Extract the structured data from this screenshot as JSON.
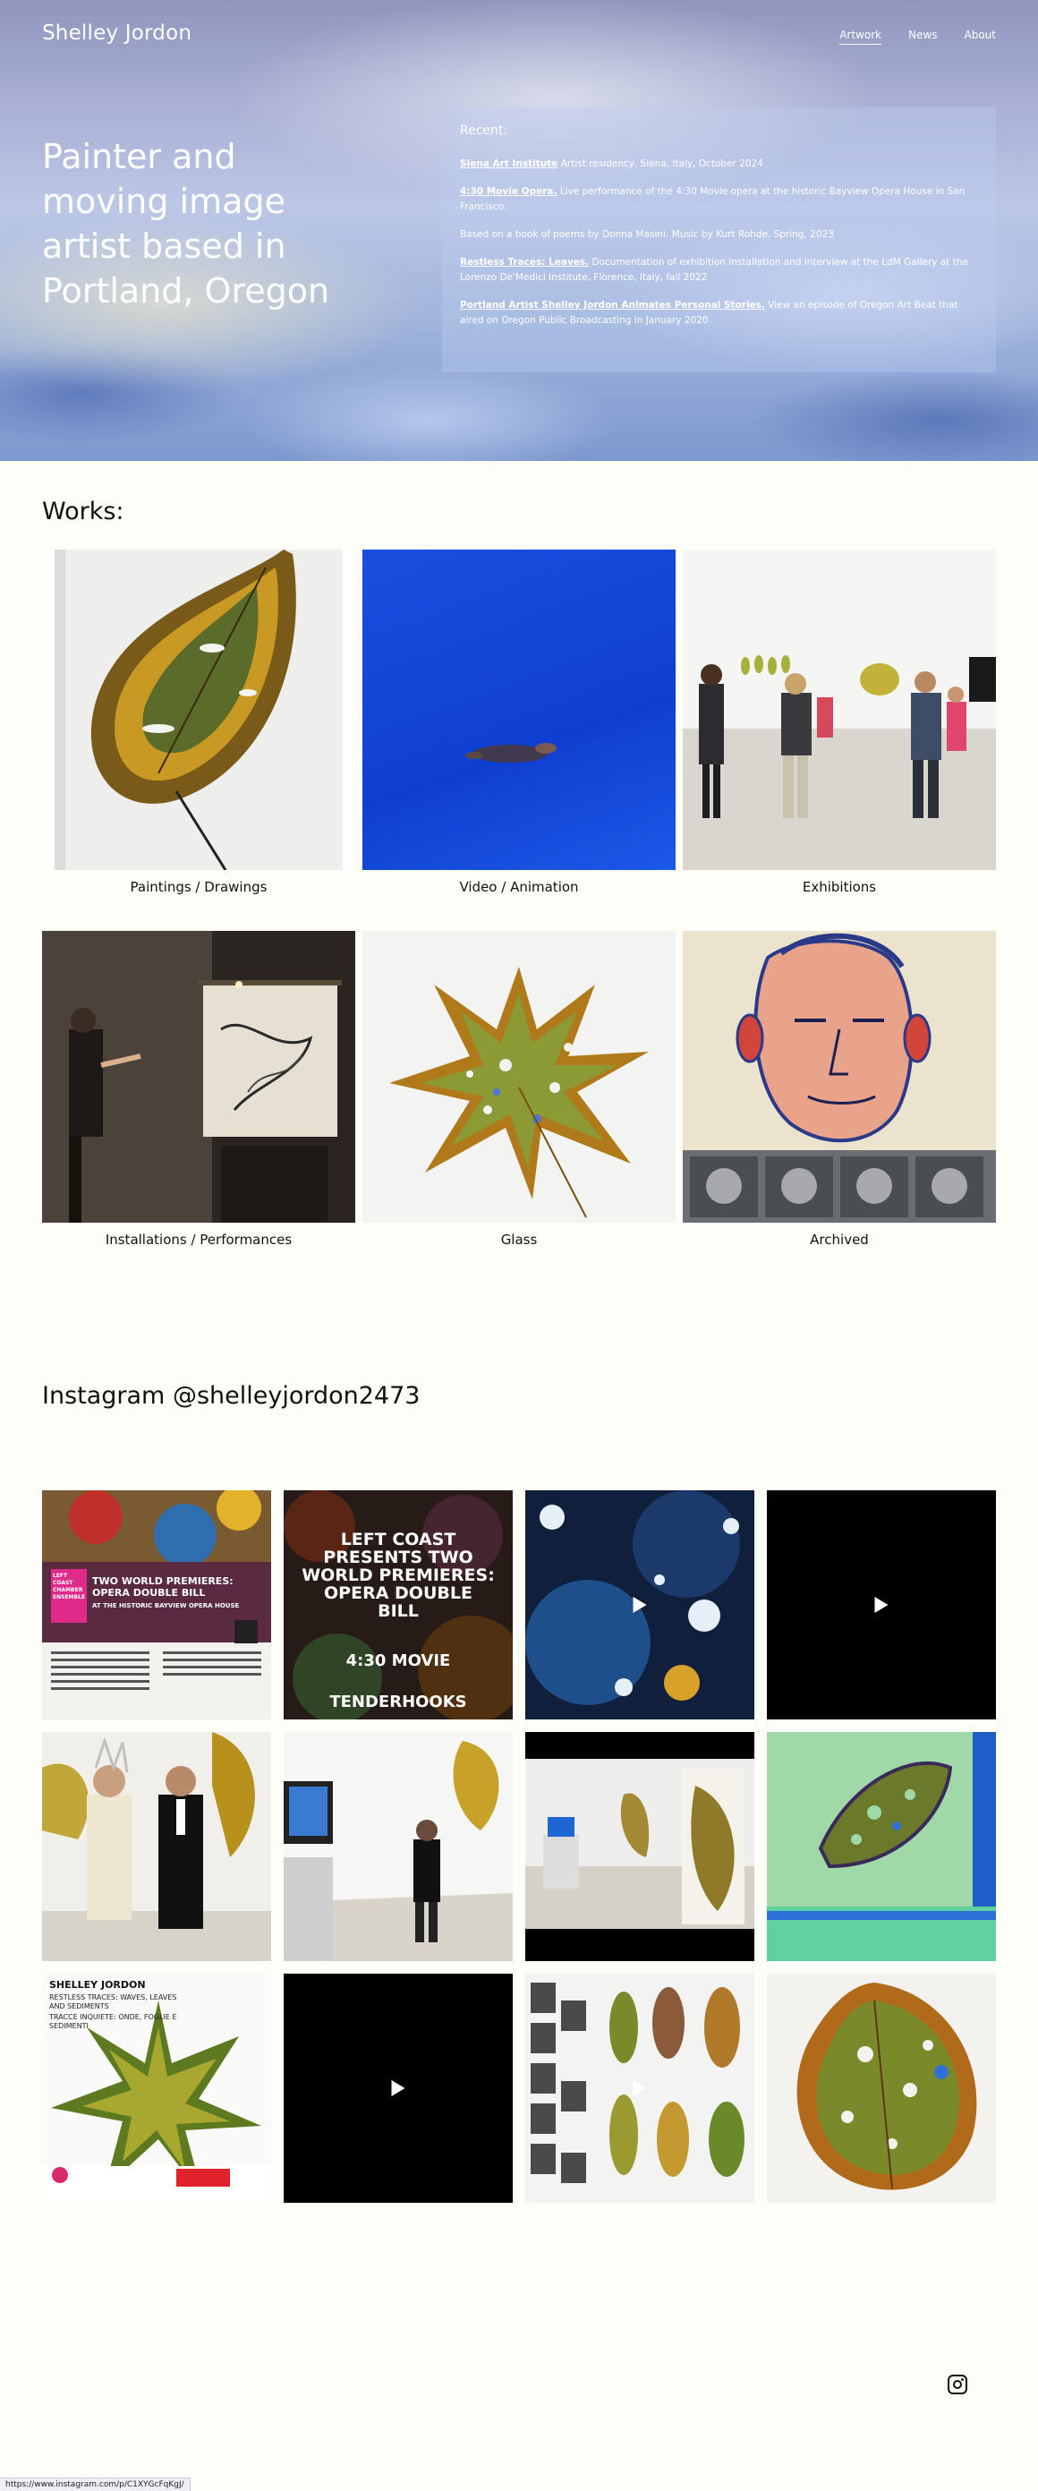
{
  "header": {
    "site_title": "Shelley Jordon",
    "nav": [
      "Artwork",
      "News",
      "About"
    ],
    "active_nav": "Artwork"
  },
  "hero": {
    "tagline": "Painter and moving image artist based in Portland, Oregon"
  },
  "recent": {
    "heading": "Recent:",
    "items": [
      {
        "link": "Siena Art Institute",
        "text": " Artist residency, Siena, Italy, October 2024"
      },
      {
        "link": "4:30 Movie Opera.",
        "text": " Live performance of the 4:30 Movie opera at the historic Bayview Opera House in San Francisco."
      },
      {
        "link": "",
        "text": " Based on a book of poems by Donna Masini. Music by Kurt Rohde. Spring, 2023"
      },
      {
        "link": "Restless Traces: Leaves.",
        "text": " Documentation of exhibition installation and interview at the LdM Gallery at the Lorenzo De'Medici Institute, Florence, Italy, fall 2022"
      },
      {
        "link": "Portland Artist Shelley Jordon Animates Personal Stories.",
        "text": " View an episode of Oregon Art Beat that aired on Oregon Public Broadcasting in January 2020."
      }
    ]
  },
  "works": {
    "heading": "Works:",
    "items": [
      {
        "label": "Paintings / Drawings"
      },
      {
        "label": "Video / Animation"
      },
      {
        "label": "Exhibitions"
      },
      {
        "label": "Installations / Performances"
      },
      {
        "label": "Glass"
      },
      {
        "label": "Archived"
      }
    ]
  },
  "instagram": {
    "heading": "Instagram @shelleyjordon2473",
    "post1": {
      "title": "TWO WORLD PREMIERES: OPERA DOUBLE BILL",
      "subtitle": "AT THE HISTORIC BAYVIEW OPERA HOUSE",
      "badge": "LEFT COAST CHAMBER ENSEMBLE"
    },
    "post2": {
      "title": "LEFT COAST PRESENTS TWO WORLD PREMIERES: OPERA DOUBLE BILL",
      "line2": "4:30 MOVIE",
      "line3": "TENDERHOOKS"
    },
    "post9": {
      "name": "SHELLEY JORDON",
      "subtitle": "RESTLESS TRACES: WAVES, LEAVES AND SEDIMENTS",
      "subtitle_it": "TRACCE INQUIETE: ONDE, FOGLIE E SEDIMENTI"
    }
  },
  "status_url": "https://www.instagram.com/p/C1XYGcFqKgJ/",
  "colors": {
    "background": "#fefef9",
    "text": "#111111",
    "hero_text": "#ffffff"
  }
}
